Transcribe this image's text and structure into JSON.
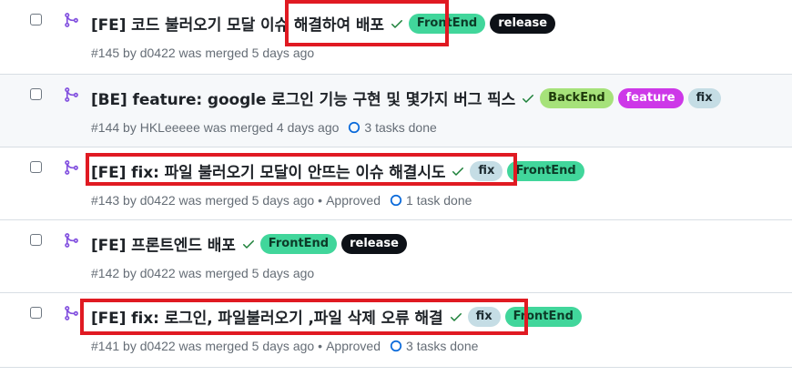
{
  "pull_requests": [
    {
      "title": "[FE] 코드 불러오기 모달 이슈 해결하여 배포",
      "meta": "#145 by d0422 was merged 5 days ago",
      "approved": "",
      "tasks": "",
      "labels": [
        {
          "text": "FrontEnd",
          "bg": "#41d69b",
          "fg": "#0c3b28"
        },
        {
          "text": "release",
          "bg": "#0d1117",
          "fg": "#ffffff"
        }
      ]
    },
    {
      "title": "[BE] feature: google 로그인 기능 구현 및 몇가지 버그 픽스",
      "meta": "#144 by HKLeeeee was merged 4 days ago",
      "approved": "",
      "tasks": "3 tasks done",
      "labels": [
        {
          "text": "BackEnd",
          "bg": "#a6e27a",
          "fg": "#1e3a0b"
        },
        {
          "text": "feature",
          "bg": "#cd38e8",
          "fg": "#ffffff"
        },
        {
          "text": "fix",
          "bg": "#c5dde5",
          "fg": "#1f2d33"
        }
      ]
    },
    {
      "title": "[FE] fix: 파일 불러오기 모달이 안뜨는 이슈 해결시도",
      "meta": "#143 by d0422 was merged 5 days ago",
      "approved": "Approved",
      "tasks": "1 task done",
      "labels": [
        {
          "text": "fix",
          "bg": "#c5dde5",
          "fg": "#1f2d33"
        },
        {
          "text": "FrontEnd",
          "bg": "#41d69b",
          "fg": "#0c3b28"
        }
      ]
    },
    {
      "title": "[FE] 프론트엔드 배포",
      "meta": "#142 by d0422 was merged 5 days ago",
      "approved": "",
      "tasks": "",
      "labels": [
        {
          "text": "FrontEnd",
          "bg": "#41d69b",
          "fg": "#0c3b28"
        },
        {
          "text": "release",
          "bg": "#0d1117",
          "fg": "#ffffff"
        }
      ]
    },
    {
      "title": "[FE] fix: 로그인, 파일불러오기 ,파일 삭제 오류 해결",
      "meta": "#141 by d0422 was merged 5 days ago",
      "approved": "Approved",
      "tasks": "3 tasks done",
      "labels": [
        {
          "text": "fix",
          "bg": "#c5dde5",
          "fg": "#1f2d33"
        },
        {
          "text": "FrontEnd",
          "bg": "#41d69b",
          "fg": "#0c3b28"
        }
      ]
    }
  ],
  "colors": {
    "merged_icon": "#8250df",
    "check_icon": "#1a7f37",
    "task_icon": "#0969da",
    "highlight": "#e01a22"
  }
}
